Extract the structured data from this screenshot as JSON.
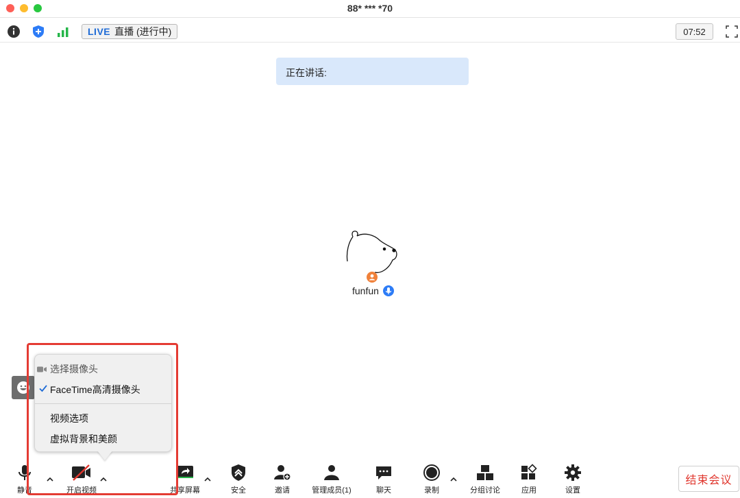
{
  "window": {
    "title": "88* *** *70"
  },
  "statusbar": {
    "live_label": "LIVE",
    "live_status": "直播 (进行中)",
    "clock": "07:52"
  },
  "speaking": {
    "label": "正在讲话:"
  },
  "participant": {
    "name": "funfun"
  },
  "video_menu": {
    "header": "选择摄像头",
    "camera_selected": "FaceTime高清摄像头",
    "video_options": "视频选项",
    "virtual_bg": "虚拟背景和美颜"
  },
  "toolbar": {
    "mute": "静音",
    "start_video": "开启视频",
    "share_screen": "共享屏幕",
    "security": "安全",
    "invite": "邀请",
    "participants": "管理成员(1)",
    "chat": "聊天",
    "record": "录制",
    "breakout": "分组讨论",
    "apps": "应用",
    "settings": "设置",
    "end_meeting": "结束会议"
  },
  "colors": {
    "accent_blue": "#1e6bd6",
    "end_red": "#e0362d",
    "highlight_red": "#e43b33",
    "speaking_bg": "#d9e8fb"
  }
}
